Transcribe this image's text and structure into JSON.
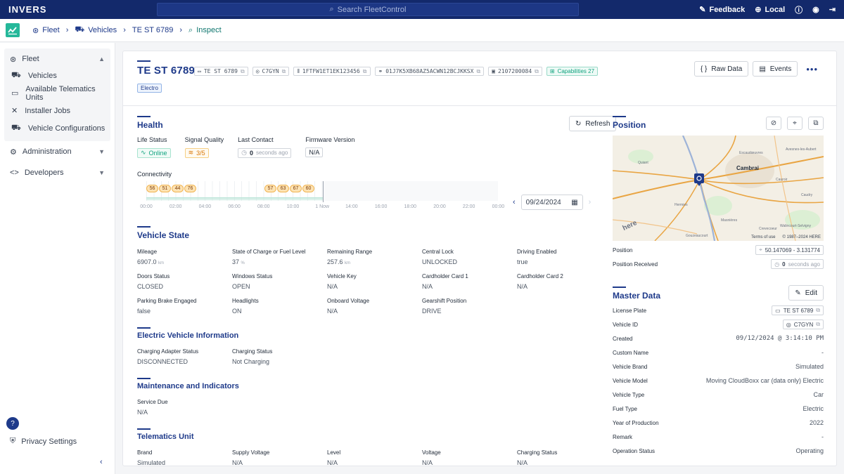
{
  "app": {
    "brand": "INVERS",
    "search_placeholder": "Search FleetControl",
    "feedback": "Feedback",
    "locale": "Local"
  },
  "breadcrumb": [
    "Fleet",
    "Vehicles",
    "TE ST 6789",
    "Inspect"
  ],
  "sidebar": {
    "fleet": "Fleet",
    "items": [
      "Vehicles",
      "Available Telematics Units",
      "Installer Jobs",
      "Vehicle Configurations"
    ],
    "administration": "Administration",
    "developers": "Developers",
    "privacy": "Privacy Settings"
  },
  "vehicle": {
    "title": "TE ST 6789",
    "chips": [
      "TE ST 6789",
      "C7GYN",
      "1FTFW1ET1EK123456",
      "01J7K5XB68AZ5ACWN12BCJKKSX",
      "2107200084"
    ],
    "capabilities": "Capabilities 27",
    "tag": "Electro"
  },
  "actions": {
    "raw_data": "Raw Data",
    "events": "Events",
    "more": "•••"
  },
  "health": {
    "title": "Health",
    "refresh": "Refresh",
    "life_status": {
      "label": "Life Status",
      "value": "Online"
    },
    "signal": {
      "label": "Signal Quality",
      "value": "3/5"
    },
    "last_contact": {
      "label": "Last Contact",
      "value": "0",
      "suffix": "seconds ago"
    },
    "firmware": {
      "label": "Firmware Version",
      "value": "N/A"
    },
    "connectivity": "Connectivity",
    "bubbles_a": [
      "56",
      "51",
      "44",
      "76"
    ],
    "bubbles_b": [
      "57",
      "63",
      "67",
      "60"
    ],
    "ticks": [
      "00:00",
      "02:00",
      "04:00",
      "06:00",
      "08:00",
      "10:00",
      "1 Now",
      "14:00",
      "16:00",
      "18:00",
      "20:00",
      "22:00",
      "00:00"
    ],
    "date": "09/24/2024"
  },
  "vehicle_state": {
    "title": "Vehicle State",
    "fields": [
      {
        "label": "Mileage",
        "value": "6907.0",
        "unit": "km"
      },
      {
        "label": "State of Charge or Fuel Level",
        "value": "37",
        "unit": "%"
      },
      {
        "label": "Remaining Range",
        "value": "257.6",
        "unit": "km"
      },
      {
        "label": "Central Lock",
        "value": "UNLOCKED"
      },
      {
        "label": "Driving Enabled",
        "value": "true"
      },
      {
        "label": "Doors Status",
        "value": "CLOSED"
      },
      {
        "label": "Windows Status",
        "value": "OPEN"
      },
      {
        "label": "Vehicle Key",
        "value": "N/A"
      },
      {
        "label": "Cardholder Card 1",
        "value": "N/A"
      },
      {
        "label": "Cardholder Card 2",
        "value": "N/A"
      },
      {
        "label": "Parking Brake Engaged",
        "value": "false"
      },
      {
        "label": "Headlights",
        "value": "ON"
      },
      {
        "label": "Onboard Voltage",
        "value": "N/A"
      },
      {
        "label": "Gearshift Position",
        "value": "DRIVE"
      }
    ]
  },
  "ev": {
    "title": "Electric Vehicle Information",
    "fields": [
      {
        "label": "Charging Adapter Status",
        "value": "DISCONNECTED"
      },
      {
        "label": "Charging Status",
        "value": "Not Charging"
      }
    ]
  },
  "maintenance": {
    "title": "Maintenance and Indicators",
    "fields": [
      {
        "label": "Service Due",
        "value": "N/A"
      }
    ]
  },
  "telematics": {
    "title": "Telematics Unit",
    "fields": [
      {
        "label": "Brand",
        "value": "Simulated"
      },
      {
        "label": "Supply Voltage",
        "value": "N/A"
      },
      {
        "label": "Level",
        "value": "N/A"
      },
      {
        "label": "Voltage",
        "value": "N/A"
      },
      {
        "label": "Charging Status",
        "value": "N/A"
      }
    ]
  },
  "position": {
    "title": "Position",
    "map_labels": [
      "Cambrai",
      "Quiant",
      "Masnières",
      "Avesnes-les-Aubert",
      "Cauroir",
      "Escaudœuvres",
      "Crevecoeur",
      "Caudry",
      "Walincourt-Selvigny",
      "Gouzeaucourt",
      "Hermies"
    ],
    "terms": "Terms of use",
    "copyright": "© 1987–2024 HERE",
    "here": "here",
    "position_label": "Position",
    "position_value": "50.147069 - 3.131774",
    "received_label": "Position Received",
    "received_value": "0",
    "received_suffix": "seconds ago"
  },
  "master": {
    "title": "Master Data",
    "edit": "Edit",
    "rows": [
      {
        "label": "License Plate",
        "value": "TE ST 6789"
      },
      {
        "label": "Vehicle ID",
        "value": "C7GYN"
      },
      {
        "label": "Created",
        "value": "09/12/2024 @ 3:14:10 PM"
      },
      {
        "label": "Custom Name",
        "value": "-"
      },
      {
        "label": "Vehicle Brand",
        "value": "Simulated"
      },
      {
        "label": "Vehicle Model",
        "value": "Moving CloudBoxx car (data only) Electric"
      },
      {
        "label": "Vehicle Type",
        "value": "Car"
      },
      {
        "label": "Fuel Type",
        "value": "Electric"
      },
      {
        "label": "Year of Production",
        "value": "2022"
      },
      {
        "label": "Remark",
        "value": "-"
      },
      {
        "label": "Operation Status",
        "value": "Operating"
      }
    ]
  }
}
